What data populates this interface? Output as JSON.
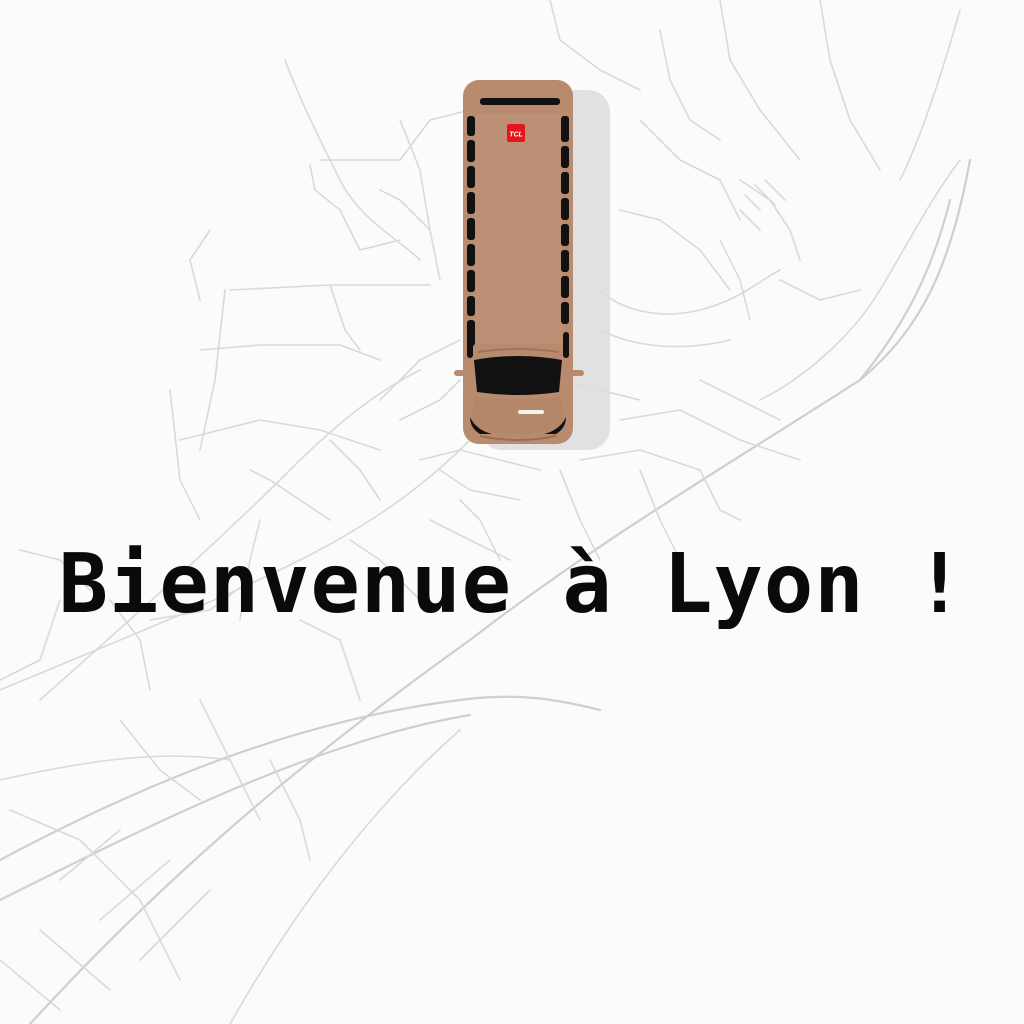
{
  "welcome": {
    "text": "Bienvenue à Lyon !"
  },
  "bus": {
    "logo_text": "TCL",
    "body_color": "#b98b6e",
    "window_color": "#111111",
    "logo_color": "#e4151b"
  },
  "map": {
    "background_color": "#fbfbfa",
    "street_color": "#d9d9d9"
  }
}
